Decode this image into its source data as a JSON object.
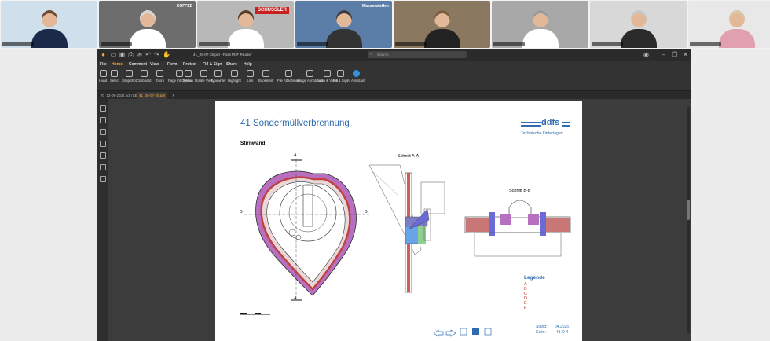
{
  "participants": [
    {
      "bg": "#cfe0ec",
      "shirt": "#1c2a4a",
      "hair": "#6a4a33"
    },
    {
      "bg": "#6d6d6d",
      "shirt": "#ffffff",
      "hair": "#d8d8d8",
      "sign_text": "COFFEE"
    },
    {
      "bg": "#b8b8b8",
      "shirt": "#ffffff",
      "hair": "#5a3b24",
      "sign_text": "SCHUSSLER"
    },
    {
      "bg": "#5a7ea8",
      "shirt": "#333333",
      "hair": "#3a3a3a",
      "sign_text": "Wasserstoffen"
    },
    {
      "bg": "#8a7860",
      "shirt": "#222222",
      "hair": "#7a5a40"
    },
    {
      "bg": "#a8a8a8",
      "shirt": "#ffffff",
      "hair": "#9a9a9a"
    },
    {
      "bg": "#d8d8d8",
      "shirt": "#2a2a2a",
      "hair": "#c8c8c8"
    },
    {
      "bg": "#e8e8e8",
      "shirt": "#e0a0b0",
      "hair": "#d8c8a8"
    }
  ],
  "app": {
    "title": "41_08-07-25.pdf - Foxit PDF Reader",
    "search_placeholder": "Search",
    "accent": "#f7a440",
    "menu": [
      {
        "label": "File",
        "active": false
      },
      {
        "label": "Home",
        "active": true
      },
      {
        "label": "Comment",
        "active": false
      },
      {
        "label": "View",
        "active": false
      },
      {
        "label": "Form",
        "active": false
      },
      {
        "label": "Protect",
        "active": false
      },
      {
        "label": "Fill & Sign",
        "active": false
      },
      {
        "label": "Share",
        "active": false
      },
      {
        "label": "Help",
        "active": false
      }
    ],
    "tools": [
      {
        "label": "Hand"
      },
      {
        "label": "Select"
      },
      {
        "label": "SnapShot"
      },
      {
        "label": "Clipboard"
      },
      {
        "label": "Zoom"
      },
      {
        "label": "Page Fit Option"
      },
      {
        "label": "Reflow"
      },
      {
        "label": "Rotate View"
      },
      {
        "label": "Typewriter"
      },
      {
        "label": "Highlight"
      },
      {
        "label": "Link"
      },
      {
        "label": "Bookmark"
      },
      {
        "label": "File Attachment"
      },
      {
        "label": "Image Annotation"
      },
      {
        "label": "Audio & Video"
      },
      {
        "label": "Fill & Sign"
      },
      {
        "label": "AI Assistant"
      }
    ],
    "tabs": [
      {
        "label": "70_12-09-2024.pdf (SEC...",
        "active": false
      },
      {
        "label": "41_08-07-25.pdf",
        "active": true
      }
    ]
  },
  "document": {
    "title": "41 Sondermüllverbrennung",
    "logo_text": "ddfs",
    "logo_subtitle": "Technische Unterlagen",
    "section_label": "Stirnwand",
    "schnitt_aa": "Schnitt A-A",
    "schnitt_bb": "Schnitt B-B",
    "marker_a": "A",
    "marker_b": "B",
    "legend_title": "Legende",
    "legend_items": [
      "A",
      "B",
      "C",
      "D",
      "E",
      "F"
    ],
    "legend_color": "#c0392b",
    "title_color": "#2e6bb0",
    "stand_label": "Stand:",
    "stand_value": "04.2025",
    "seite_label": "Seite:",
    "seite_value": "41-D-4"
  }
}
